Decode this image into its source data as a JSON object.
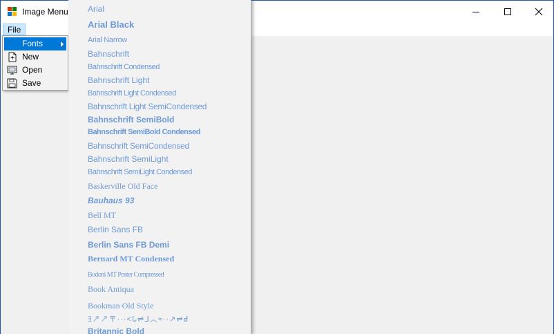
{
  "window": {
    "title": "Image Menu",
    "controls": [
      "minimize-icon",
      "maximize-icon",
      "close-icon"
    ]
  },
  "menubar": {
    "file_label": "File"
  },
  "file_menu": {
    "items": [
      {
        "label": "Fonts",
        "icon": "none",
        "has_submenu": true,
        "highlighted": true
      },
      {
        "label": "New",
        "icon": "new-document-icon"
      },
      {
        "label": "Open",
        "icon": "open-monitor-icon"
      },
      {
        "label": "Save",
        "icon": "floppy-disk-icon"
      }
    ]
  },
  "fonts_submenu": {
    "text_color": "#6e9ad6",
    "highlight_color": "#0078d7",
    "items": [
      {
        "label": "Arial"
      },
      {
        "label": "Arial Black"
      },
      {
        "label": "Arial Narrow"
      },
      {
        "label": "Bahnschrift"
      },
      {
        "label": "Bahnschrift Condensed"
      },
      {
        "label": "Bahnschrift Light"
      },
      {
        "label": "Bahnschrift Light Condensed"
      },
      {
        "label": "Bahnschrift Light SemiCondensed"
      },
      {
        "label": "Bahnschrift SemiBold"
      },
      {
        "label": "Bahnschrift SemiBold Condensed"
      },
      {
        "label": "Bahnschrift SemiCondensed"
      },
      {
        "label": "Bahnschrift SemiLight"
      },
      {
        "label": "Bahnschrift SemiLight Condensed"
      },
      {
        "label": "Baskerville Old Face"
      },
      {
        "label": "Bauhaus 93"
      },
      {
        "label": "Bell MT"
      },
      {
        "label": "Berlin Sans FB"
      },
      {
        "label": "Berlin Sans FB Demi"
      },
      {
        "label": "Bernard MT Condensed"
      },
      {
        "label": "Bodoni MT Poster Compressed"
      },
      {
        "label": "Book Antiqua"
      },
      {
        "label": "Bookman Old Style"
      },
      {
        "label": "ﾖ↗↗〒···<ᒐ⇌ᒧ︿≈··↗⇌ᑯ"
      },
      {
        "label": "Britannic Bold"
      }
    ]
  }
}
